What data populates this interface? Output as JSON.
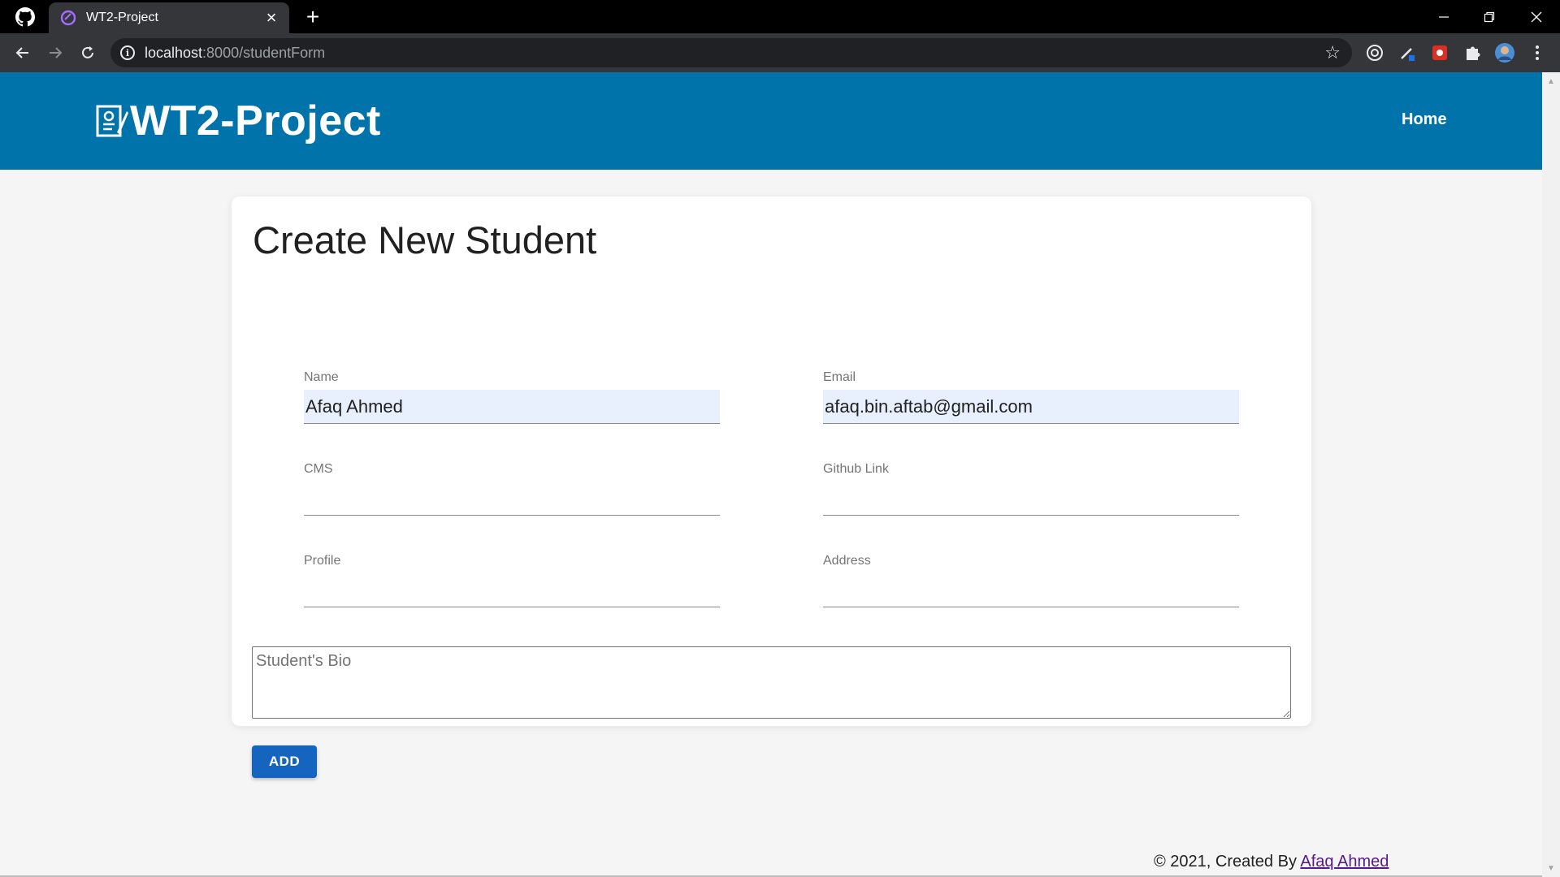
{
  "browser": {
    "tab_title": "WT2-Project",
    "new_tab_symbol": "+",
    "url_host": "localhost",
    "url_path": ":8000/studentForm"
  },
  "header": {
    "brand": "WT2-Project",
    "nav_home": "Home"
  },
  "form": {
    "title": "Create New Student",
    "fields": [
      {
        "label": "Name",
        "value": "Afaq Ahmed"
      },
      {
        "label": "Email",
        "value": "afaq.bin.aftab@gmail.com"
      },
      {
        "label": "CMS",
        "value": ""
      },
      {
        "label": "Github Link",
        "value": ""
      },
      {
        "label": "Profile",
        "value": ""
      },
      {
        "label": "Address",
        "value": ""
      }
    ],
    "bio_placeholder": "Student's Bio",
    "submit_label": "ADD"
  },
  "footer": {
    "text": "© 2021, Created By ",
    "author_link": "Afaq Ahmed"
  },
  "colors": {
    "header_bg": "#0073aa",
    "button_bg": "#1565c0",
    "autofill_bg": "#e8f0fe"
  }
}
